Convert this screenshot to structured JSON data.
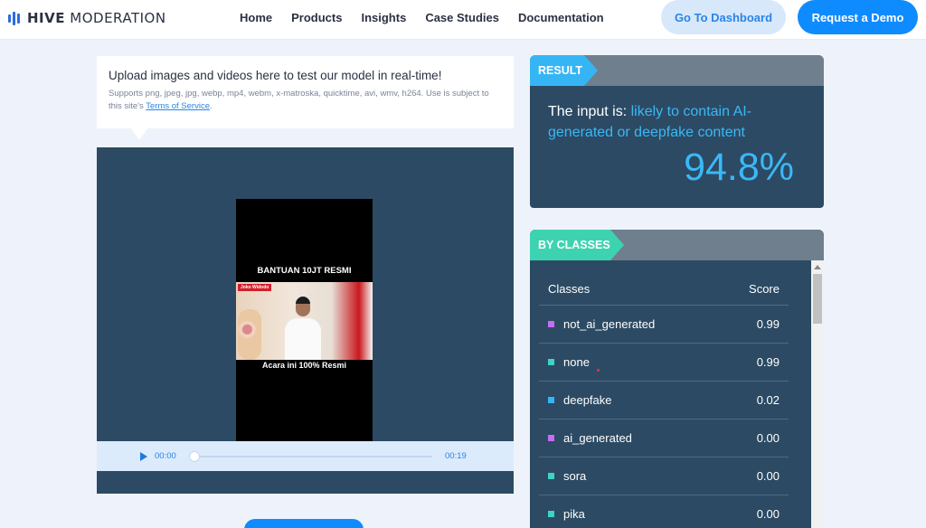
{
  "header": {
    "logo_bold": "HIVE",
    "logo_light": "MODERATION",
    "nav": [
      "Home",
      "Products",
      "Insights",
      "Case Studies",
      "Documentation"
    ],
    "dashboard_button": "Go To Dashboard",
    "demo_button": "Request a Demo"
  },
  "upload": {
    "title": "Upload images and videos here to test our model in real-time!",
    "desc_prefix": "Supports png, jpeg, jpg, webp, mp4, webm, x-matroska, quicktime, avi, wmv, h264. Use is subject to this site's ",
    "terms_link": "Terms of Service",
    "desc_suffix": "."
  },
  "video": {
    "caption_top": "BANTUAN 10JT RESMI",
    "name_tag": "Joko Widodo",
    "caption_bottom": "Acara ini 100% Resmi",
    "current_time": "00:00",
    "total_time": "00:19",
    "progress": 0
  },
  "result": {
    "tag": "RESULT",
    "prefix": "The input is: ",
    "verdict": "likely to contain AI-generated or deepfake content",
    "score": "94.8%"
  },
  "classes": {
    "tag": "BY CLASSES",
    "col_class": "Classes",
    "col_score": "Score",
    "rows": [
      {
        "name": "not_ai_generated",
        "score": "0.99",
        "color": "#c86cf0"
      },
      {
        "name": "none",
        "score": "0.99",
        "color": "#3ed3c8"
      },
      {
        "name": "deepfake",
        "score": "0.02",
        "color": "#36b5f5"
      },
      {
        "name": "ai_generated",
        "score": "0.00",
        "color": "#c86cf0"
      },
      {
        "name": "sora",
        "score": "0.00",
        "color": "#3ed3c8"
      },
      {
        "name": "pika",
        "score": "0.00",
        "color": "#3ed3c8"
      }
    ]
  }
}
